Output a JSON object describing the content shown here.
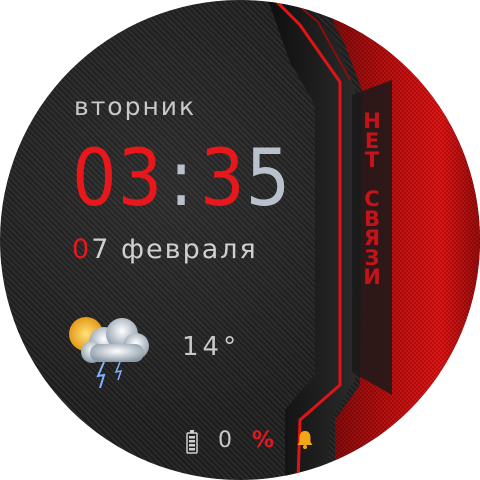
{
  "watch_face": {
    "day_of_week": "вторник",
    "time": {
      "hour": "03",
      "separator": ":",
      "minute": "35"
    },
    "date": {
      "day_first_digit": "0",
      "day_second_digit": "7",
      "month": "февраля"
    },
    "weather": {
      "icon": "thunderstorm-partly-sunny-icon",
      "temperature": "14°"
    },
    "status_vertical": "НЕТ СВЯЗИ",
    "battery": {
      "icon": "battery-icon",
      "value": "0",
      "unit": "%"
    },
    "alarm_icon": "bell-icon"
  },
  "colors": {
    "accent_red": "#e8171b",
    "time_grey": "#b9c2cc",
    "text_grey": "#c9c9c9",
    "background": "#1e1e1e"
  }
}
